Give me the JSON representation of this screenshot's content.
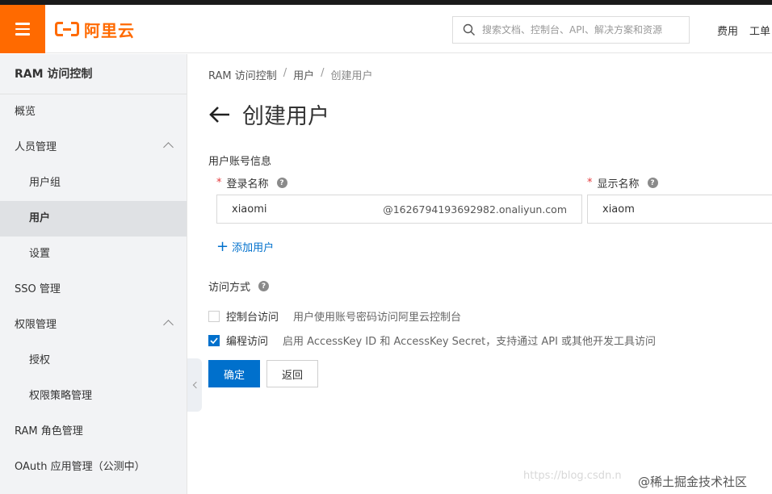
{
  "header": {
    "brand_name": "阿里云",
    "search_placeholder": "搜索文档、控制台、API、解决方案和资源",
    "links": [
      "费用",
      "工单"
    ]
  },
  "sidebar": {
    "title": "RAM 访问控制",
    "items": [
      {
        "label": "概览"
      },
      {
        "label": "人员管理"
      },
      {
        "label": "用户组"
      },
      {
        "label": "用户"
      },
      {
        "label": "设置"
      },
      {
        "label": "SSO 管理"
      },
      {
        "label": "权限管理"
      },
      {
        "label": "授权"
      },
      {
        "label": "权限策略管理"
      },
      {
        "label": "RAM 角色管理"
      },
      {
        "label": "OAuth 应用管理（公测中）"
      }
    ]
  },
  "breadcrumb": {
    "items": [
      "RAM 访问控制",
      "用户",
      "创建用户"
    ],
    "separator": "/"
  },
  "page": {
    "title": "创建用户"
  },
  "form": {
    "section_account": "用户账号信息",
    "required_mark": "*",
    "help_glyph": "?",
    "login_name_label": "登录名称",
    "login_name_value": "xiaomi",
    "login_name_suffix": "@1626794193692982.onaliyun.com",
    "display_name_label": "显示名称",
    "display_name_value": "xiaom",
    "add_user_plus": "+",
    "add_user_label": "添加用户",
    "access_mode_label": "访问方式",
    "options": [
      {
        "label": "控制台访问",
        "description": "用户使用账号密码访问阿里云控制台",
        "checked": false
      },
      {
        "label": "编程访问",
        "description": "启用 AccessKey ID 和 AccessKey Secret，支持通过 API 或其他开发工具访问",
        "checked": true
      }
    ]
  },
  "actions": {
    "confirm": "确定",
    "back": "返回"
  },
  "watermarks": {
    "url": "https://blog.csdn.n",
    "community": "@稀土掘金技术社区"
  },
  "colors": {
    "brand": "#ff6a00",
    "primary": "#0070cc",
    "required": "#e4393c"
  }
}
